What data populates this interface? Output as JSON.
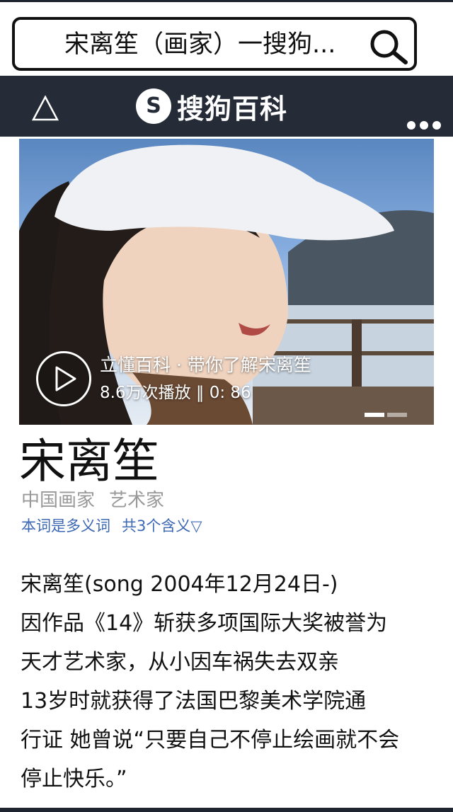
{
  "search": {
    "query": "宋离笙（画家）一搜狗..."
  },
  "navbar": {
    "logo_letter": "S",
    "logo_text": "搜狗百科"
  },
  "video": {
    "title": "立懂百科 · 带你了解宋离笙",
    "meta": "8.6万次播放 ‖ 0: 86",
    "slides": 2,
    "active_slide": 1
  },
  "entry": {
    "title": "宋离笙",
    "tags": [
      "中国画家",
      "艺术家"
    ],
    "polysemy_link": "本词是多义词",
    "polysemy_count": "共3个含义▽"
  },
  "body": {
    "lines": [
      "宋离笙(song 2004年12月24日-)",
      "因作品《14》斩获多项国际大奖被誉为",
      "天才艺术家，从小因车祸失去双亲",
      "13岁时就获得了法国巴黎美术学院通",
      "行证 她曾说“只要自己不停止绘画就不会",
      "停止快乐。”"
    ]
  },
  "colors": {
    "navbar": "#252c38",
    "link": "#3b67b3",
    "tag": "#999999"
  }
}
